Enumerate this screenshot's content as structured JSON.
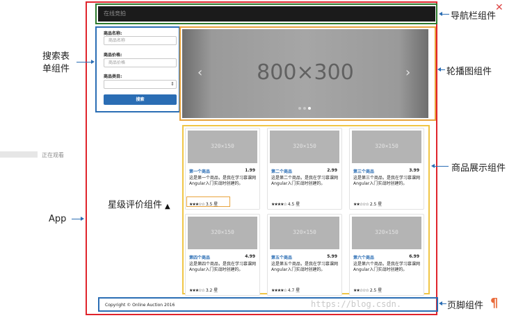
{
  "navbar": {
    "brand": "在线竞拍"
  },
  "search": {
    "name_label": "商品名称:",
    "name_placeholder": "商品名称",
    "price_label": "商品价格:",
    "price_placeholder": "商品价格",
    "category_label": "商品类目:",
    "button_label": "搜索"
  },
  "carousel": {
    "placeholder_text": "800×300",
    "prev_icon": "‹",
    "next_icon": "›",
    "dots": 3,
    "active_dot": 2
  },
  "products": [
    {
      "thumb": "320×150",
      "name": "第一个商品",
      "price": "1.99",
      "desc": "这是第一个商品，是我在学习慕课网Angular入门实战时创建的。",
      "stars": "★★★☆☆",
      "rating": "3.5 星"
    },
    {
      "thumb": "320×150",
      "name": "第二个商品",
      "price": "2.99",
      "desc": "这是第二个商品，是我在学习慕课网Angular入门实战时创建的。",
      "stars": "★★★★☆",
      "rating": "4.5 星"
    },
    {
      "thumb": "320×150",
      "name": "第三个商品",
      "price": "3.99",
      "desc": "这是第三个商品，是我在学习慕课网Angular入门实战时创建的。",
      "stars": "★★☆☆☆",
      "rating": "2.5 星"
    },
    {
      "thumb": "320×150",
      "name": "第四个商品",
      "price": "4.99",
      "desc": "这是第四个商品，是我在学习慕课网Angular入门实战时创建的。",
      "stars": "★★★☆☆",
      "rating": "3.2 星"
    },
    {
      "thumb": "320×150",
      "name": "第五个商品",
      "price": "5.99",
      "desc": "这是第五个商品，是我在学习慕课网Angular入门实战时创建的。",
      "stars": "★★★★☆",
      "rating": "4.7 星"
    },
    {
      "thumb": "320×150",
      "name": "第六个商品",
      "price": "6.99",
      "desc": "这是第六个商品，是我在学习慕课网Angular入门实战时创建的。",
      "stars": "★★☆☆☆",
      "rating": "2.5 星"
    }
  ],
  "footer": {
    "text": "Copyright © Online Auction 2016"
  },
  "annotations": {
    "navbar": "导航栏组件",
    "search_line1": "搜索表",
    "search_line2": "单组件",
    "carousel": "轮播图组件",
    "products": "商品展示组件",
    "rating": "星级评价组件",
    "app": "App",
    "footer": "页脚组件",
    "watching": "正在观看"
  },
  "watermark": "https://blog.csdn.",
  "colors": {
    "app_frame": "#e0232b",
    "navbar_frame": "#2c7a2c",
    "search_frame": "#2a6db4",
    "carousel_frame": "#e8a33b",
    "products_frame": "#f0c545",
    "footer_frame": "#2a6db4",
    "navbar_bg": "#1b1b1b",
    "primary_button": "#2a6db4"
  }
}
